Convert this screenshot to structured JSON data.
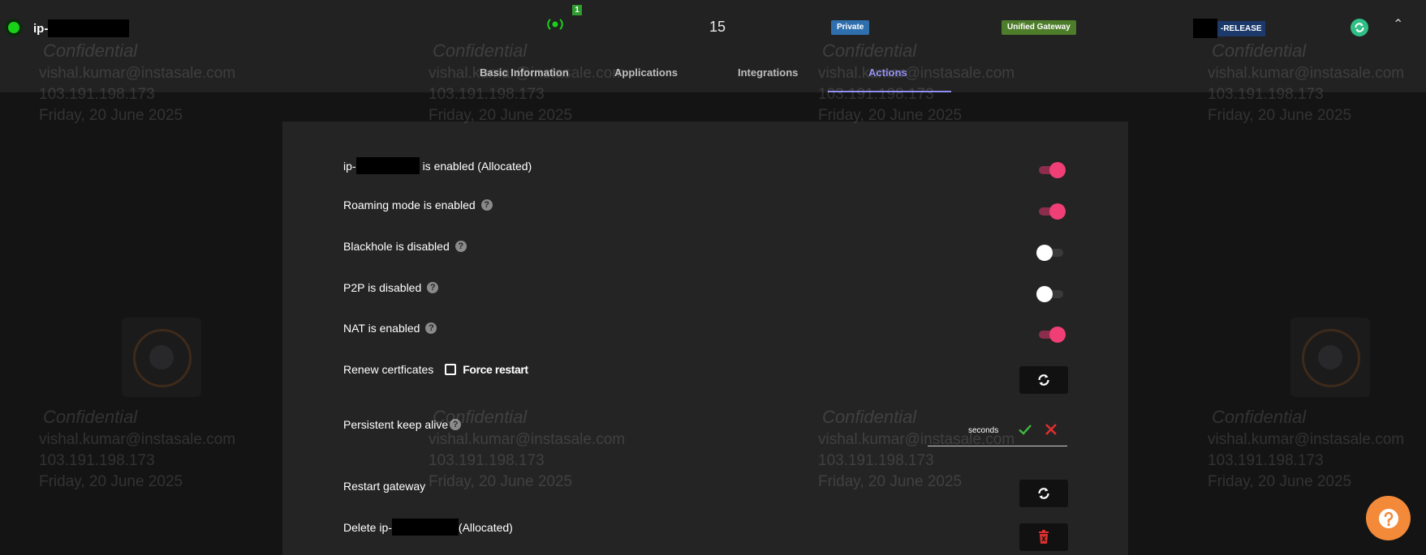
{
  "header": {
    "host_prefix": "ip-",
    "connections_badge": "1",
    "count": "15",
    "private_badge": "Private",
    "gateway_badge": "Unified Gateway",
    "release_suffix": "-RELEASE"
  },
  "tabs": [
    {
      "label": "Basic Information",
      "active": false
    },
    {
      "label": "Applications",
      "active": false
    },
    {
      "label": "Integrations",
      "active": false
    },
    {
      "label": "Actions",
      "active": true
    }
  ],
  "watermark": {
    "label": "Confidential",
    "email": "vishal.kumar@instasale.com",
    "ip": "103.191.198.173",
    "date": "Friday, 20 June 2025"
  },
  "actions": {
    "enabled_prefix": "ip-",
    "enabled_suffix": "is enabled (Allocated)",
    "roaming": "Roaming mode is enabled",
    "blackhole": "Blackhole is disabled",
    "p2p": "P2P is disabled",
    "nat": "NAT is enabled",
    "renew": "Renew certficates",
    "force_restart": "Force restart",
    "keep_alive": "Persistent keep alive",
    "keep_alive_unit": "seconds",
    "restart": "Restart gateway",
    "delete_prefix": "Delete ip-",
    "delete_suffix": "(Allocated)"
  },
  "toggles": {
    "allocated": true,
    "roaming": true,
    "blackhole": false,
    "p2p": false,
    "nat": true
  },
  "colors": {
    "accent": "#8f8cf2",
    "toggle_on": "#ef3f76",
    "status_online": "#1ad11a",
    "delete": "#e0302e",
    "help_fab": "#f28a3a"
  }
}
